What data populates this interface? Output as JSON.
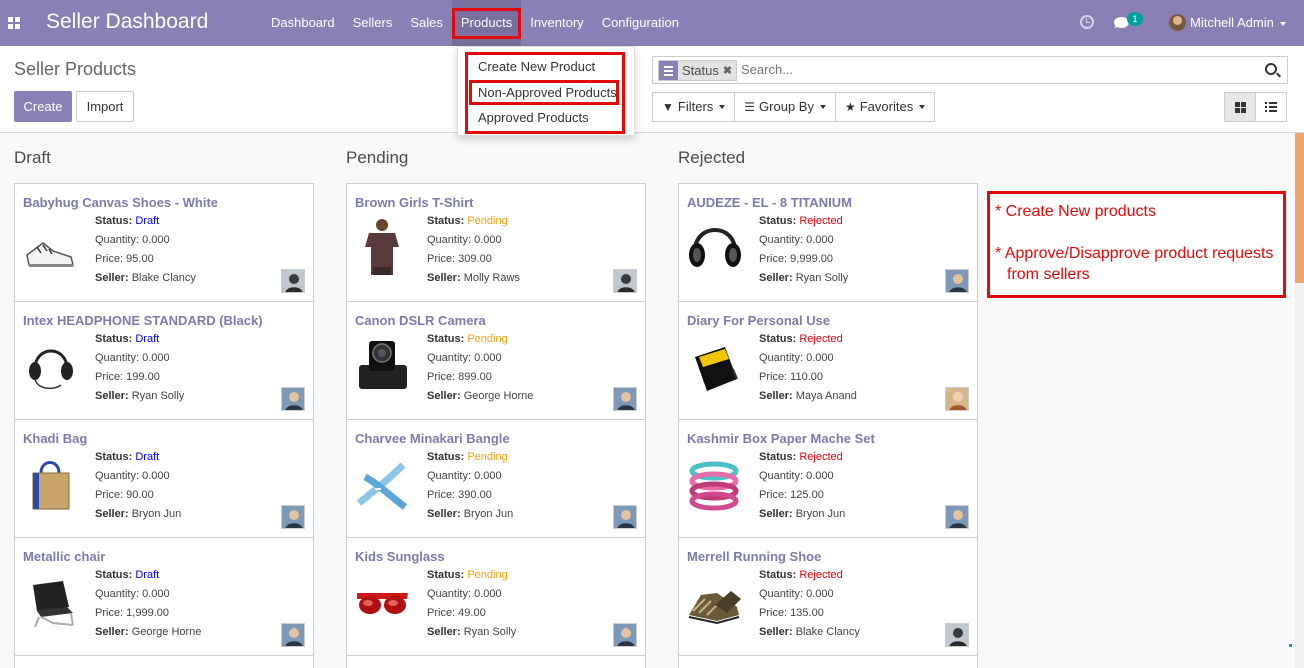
{
  "navbar": {
    "title": "Seller Dashboard",
    "menu": [
      "Dashboard",
      "Sellers",
      "Sales",
      "Products",
      "Inventory",
      "Configuration"
    ],
    "active_menu": "Products",
    "chat_badge": "1",
    "user_name": "Mitchell Admin",
    "accent_color": "#8a80b6"
  },
  "control_panel": {
    "breadcrumb": "Seller Products",
    "create_label": "Create",
    "import_label": "Import",
    "facet_label": "Status",
    "facet_remove": "✖",
    "search_placeholder": "Search...",
    "filters_label": "Filters",
    "groupby_label": "Group By",
    "favorites_label": "Favorites"
  },
  "dropdown": {
    "items": [
      "Create New Product",
      "Non-Approved Products",
      "Approved Products"
    ]
  },
  "kanban": {
    "status_label": "Status:",
    "seller_label": "Seller:",
    "columns": [
      {
        "title": "Draft",
        "status_class": "st-draft",
        "cards": [
          {
            "name": "Babyhug Canvas Shoes - White",
            "status": "Draft",
            "quantity": "Quantity: 0.000",
            "price": "Price: 95.00",
            "seller": "Blake Clancy",
            "image": "shoe"
          },
          {
            "name": "Intex HEADPHONE STANDARD (Black)",
            "status": "Draft",
            "quantity": "Quantity: 0.000",
            "price": "Price: 199.00",
            "seller": "Ryan Solly",
            "image": "headset"
          },
          {
            "name": "Khadi Bag",
            "status": "Draft",
            "quantity": "Quantity: 0.000",
            "price": "Price: 90.00",
            "seller": "Bryon Jun",
            "image": "bag"
          },
          {
            "name": "Metallic chair",
            "status": "Draft",
            "quantity": "Quantity: 0.000",
            "price": "Price: 1,999.00",
            "seller": "George Horne",
            "image": "chair"
          }
        ]
      },
      {
        "title": "Pending",
        "status_class": "st-pending",
        "cards": [
          {
            "name": "Brown Girls T-Shirt",
            "status": "Pending",
            "quantity": "Quantity: 0.000",
            "price": "Price: 309.00",
            "seller": "Molly Raws",
            "image": "tshirt"
          },
          {
            "name": "Canon DSLR Camera",
            "status": "Pending",
            "quantity": "Quantity: 0.000",
            "price": "Price: 899.00",
            "seller": "George Horne",
            "image": "camera"
          },
          {
            "name": "Charvee Minakari Bangle",
            "status": "Pending",
            "quantity": "Quantity: 0.000",
            "price": "Price: 390.00",
            "seller": "Bryon Jun",
            "image": "bangle"
          },
          {
            "name": "Kids Sunglass",
            "status": "Pending",
            "quantity": "Quantity: 0.000",
            "price": "Price: 49.00",
            "seller": "Ryan Solly",
            "image": "sunglass"
          }
        ]
      },
      {
        "title": "Rejected",
        "status_class": "st-rejected",
        "cards": [
          {
            "name": "AUDEZE - EL - 8 TITANIUM",
            "status": "Rejected",
            "quantity": "Quantity: 0.000",
            "price": "Price: 9,999.00",
            "seller": "Ryan Solly",
            "image": "headphones"
          },
          {
            "name": "Diary For Personal Use",
            "status": "Rejected",
            "quantity": "Quantity: 0.000",
            "price": "Price: 110.00",
            "seller": "Maya Anand",
            "image": "diary"
          },
          {
            "name": "Kashmir Box Paper Mache Set",
            "status": "Rejected",
            "quantity": "Quantity: 0.000",
            "price": "Price: 125.00",
            "seller": "Bryon Jun",
            "image": "bracelets"
          },
          {
            "name": "Merrell Running Shoe",
            "status": "Rejected",
            "quantity": "Quantity: 0.000",
            "price": "Price: 135.00",
            "seller": "Blake Clancy",
            "image": "runningshoe"
          }
        ]
      }
    ]
  },
  "annotation": {
    "line1": "* Create New products",
    "line2": "* Approve/Disapprove product requests",
    "line3": "from sellers"
  }
}
